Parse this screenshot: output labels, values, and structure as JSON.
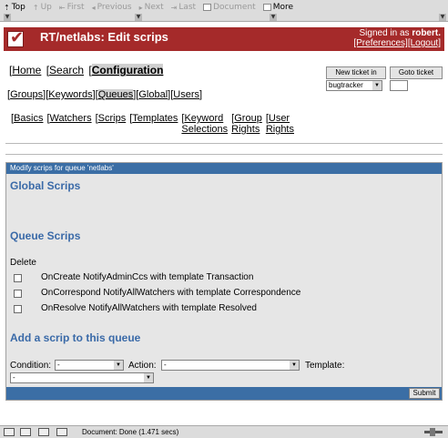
{
  "browser": {
    "nav": [
      {
        "label": "Top",
        "icon": "home-icon",
        "enabled": true
      },
      {
        "label": "Up",
        "icon": "up-icon",
        "enabled": false
      },
      {
        "label": "First",
        "icon": "first-icon",
        "enabled": false
      },
      {
        "label": "Previous",
        "icon": "previous-icon",
        "enabled": false
      },
      {
        "label": "Next",
        "icon": "next-icon",
        "enabled": false
      },
      {
        "label": "Last",
        "icon": "last-icon",
        "enabled": false
      },
      {
        "label": "Document",
        "icon": "document-icon",
        "enabled": false
      },
      {
        "label": "More",
        "icon": "more-icon",
        "enabled": true
      }
    ],
    "status": "Document: Done (1.471 secs)"
  },
  "header": {
    "title": "RT/netlabs: Edit scrips",
    "signed_prefix": "Signed in as ",
    "user": "robert.",
    "preferences": "[Preferences]",
    "logout": "[Logout]",
    "brand_color": "#a52a2a"
  },
  "menu_main": [
    {
      "label": "Home",
      "active": false
    },
    {
      "label": "Search",
      "active": false
    },
    {
      "label": "Configuration",
      "active": true
    }
  ],
  "menu_sub": [
    {
      "label": "Groups",
      "active": false
    },
    {
      "label": "Keywords",
      "active": false
    },
    {
      "label": "Queues",
      "active": true
    },
    {
      "label": "Global",
      "active": false
    },
    {
      "label": "Users",
      "active": false
    }
  ],
  "menu_queue": [
    {
      "line1": "Basics",
      "line2": ""
    },
    {
      "line1": "Watchers",
      "line2": ""
    },
    {
      "line1": "Scrips",
      "line2": ""
    },
    {
      "line1": "Templates",
      "line2": ""
    },
    {
      "line1": "Keyword",
      "line2": "Selections"
    },
    {
      "line1": "Group",
      "line2": "Rights"
    },
    {
      "line1": "User",
      "line2": "Rights"
    }
  ],
  "quick": {
    "new_ticket_button": "New ticket in",
    "goto_ticket_button": "Goto ticket",
    "queue_select": "bugtracker"
  },
  "panel": {
    "title": "Modify scrips for queue 'netlabs'",
    "global_heading": "Global Scrips",
    "queue_heading": "Queue Scrips",
    "delete_label": "Delete",
    "scrips": [
      "OnCreate NotifyAdminCcs with template Transaction",
      "OnCorrespond NotifyAllWatchers with template Correspondence",
      "OnResolve NotifyAllWatchers with template Resolved"
    ],
    "add_heading": "Add a scrip to this queue",
    "condition_label": "Condition:",
    "condition_value": "-",
    "action_label": "Action:",
    "action_value": "-",
    "template_label": "Template:",
    "template_value": "-",
    "submit": "Submit",
    "accent_color": "#3b6ea5"
  }
}
